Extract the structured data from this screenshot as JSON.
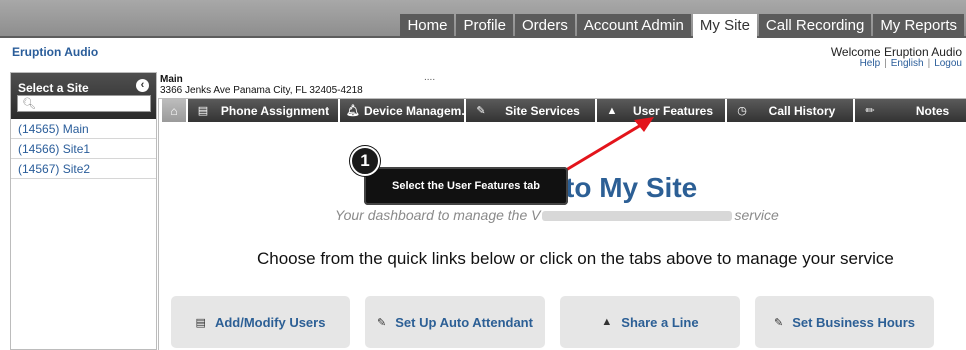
{
  "top_nav": [
    "Home",
    "Profile",
    "Orders",
    "Account Admin",
    "My Site",
    "Call Recording",
    "My Reports"
  ],
  "active_nav": "My Site",
  "header": {
    "brand": "Eruption Audio",
    "welcome": "Welcome Eruption Audio",
    "help": "Help",
    "language": "English",
    "logout": "Logou"
  },
  "sidebar": {
    "title": "Select a Site",
    "search_placeholder": "",
    "sites": [
      "(14565) Main",
      "(14566) Site1",
      "(14567) Site2"
    ]
  },
  "location": {
    "name": "Main",
    "address": "3366 Jenks Ave Panama City, FL 32405-4218",
    "dots": "...."
  },
  "tabs": [
    {
      "label": "Phone Assignment",
      "icon": "phone-list-icon"
    },
    {
      "label": "Device Managem...",
      "icon": "bell-icon"
    },
    {
      "label": "Site Services",
      "icon": "edit-icon"
    },
    {
      "label": "User Features",
      "icon": "user-icon"
    },
    {
      "label": "Call History",
      "icon": "clock-icon"
    },
    {
      "label": "Notes",
      "icon": "pencil-icon"
    }
  ],
  "dashboard": {
    "title": "to My Site",
    "subtitle_start": "Your dashboard to manage the V",
    "subtitle_end": "service",
    "quick_text": "Choose from the quick links below or click on the tabs above to manage your service"
  },
  "quick_links": [
    {
      "label": "Add/Modify Users",
      "icon": "user-list-icon"
    },
    {
      "label": "Set Up Auto Attendant",
      "icon": "edit-icon"
    },
    {
      "label": "Share a Line",
      "icon": "user-icon"
    },
    {
      "label": "Set Business Hours",
      "icon": "edit-icon"
    }
  ],
  "callout": {
    "number": "1",
    "text": "Select the User Features tab"
  },
  "colors": {
    "accent": "#2c5f95",
    "arrow": "#e3141b"
  }
}
